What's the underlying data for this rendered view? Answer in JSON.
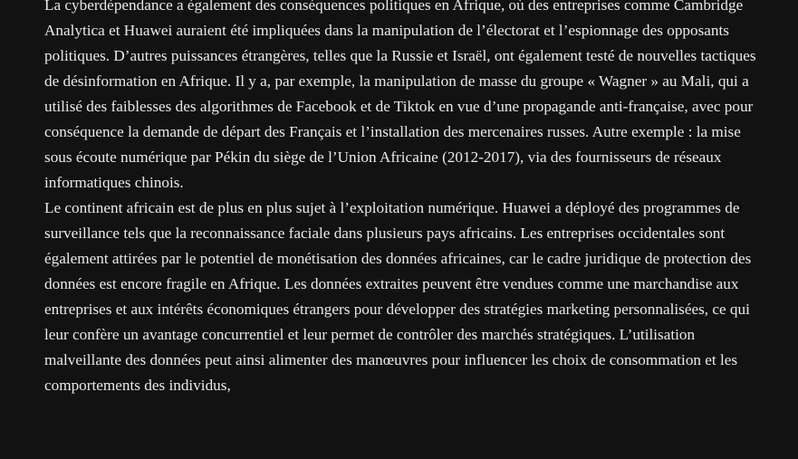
{
  "article": {
    "paragraphs": [
      "La cyberdépendance a également des conséquences politiques en Afrique, où des entreprises comme Cambridge Analytica et Huawei auraient été impliquées dans la manipulation de l’électorat et l’espionnage des opposants politiques. D’autres puissances étrangères, telles que la Russie et Israël, ont également testé de nouvelles tactiques de désinformation en Afrique. Il y a, par exemple, la manipulation de masse du groupe « Wagner » au Mali, qui a utilisé des faiblesses des algorithmes de Facebook et de Tiktok en vue d’une propagande anti-française, avec pour conséquence la demande de départ des Français et l’installation des mercenaires russes. Autre exemple : la mise sous écoute numérique par Pékin du siège de l’Union Africaine (2012-2017), via des fournisseurs de réseaux informatiques chinois.",
      "Le continent africain est de plus en plus sujet à l’exploitation numérique. Huawei a déployé des programmes de surveillance tels que la reconnaissance faciale dans plusieurs pays africains. Les entreprises occidentales sont également attirées par le potentiel de monétisation des données africaines, car le cadre juridique de protection des données est encore fragile en Afrique. Les données extraites peuvent être vendues comme une marchandise aux entreprises et aux intérêts économiques étrangers pour développer des stratégies marketing personnalisées, ce qui leur confère un avantage concurrentiel et leur permet de contrôler des marchés stratégiques. L’utilisation malveillante des données peut ainsi alimenter des manœuvres pour influencer les choix de consommation et les comportements des individus,"
    ]
  }
}
